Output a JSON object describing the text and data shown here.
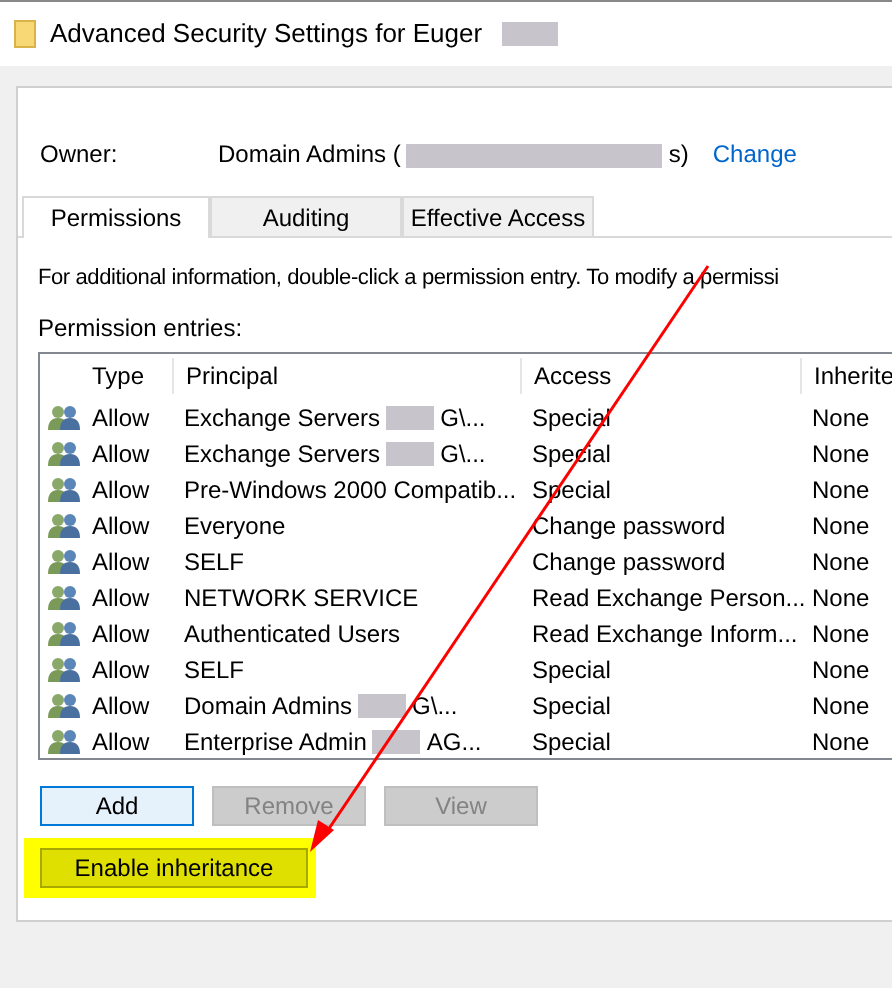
{
  "window": {
    "title": "Advanced Security Settings for Euger"
  },
  "owner": {
    "label": "Owner:",
    "value": "Domain Admins (",
    "value_end": "s)",
    "link": "Change"
  },
  "tabs": [
    {
      "label": "Permissions",
      "selected": true
    },
    {
      "label": "Auditing",
      "selected": false
    },
    {
      "label": "Effective Access",
      "selected": false
    }
  ],
  "info": "For additional information, double-click a permission entry. To modify a permissi",
  "entries_label": "Permission entries:",
  "table": {
    "columns": [
      "Type",
      "Principal",
      "Access",
      "Inherite"
    ],
    "rows": [
      {
        "type": "Allow",
        "principal": "Exchange Servers",
        "principal_end": "G\\...",
        "access": "Special",
        "inherited": "None"
      },
      {
        "type": "Allow",
        "principal": "Exchange Servers",
        "principal_end": "G\\...",
        "access": "Special",
        "inherited": "None"
      },
      {
        "type": "Allow",
        "principal": "Pre-Windows 2000 Compatib...",
        "access": "Special",
        "inherited": "None"
      },
      {
        "type": "Allow",
        "principal": "Everyone",
        "access": "Change password",
        "inherited": "None"
      },
      {
        "type": "Allow",
        "principal": "SELF",
        "access": "Change password",
        "inherited": "None"
      },
      {
        "type": "Allow",
        "principal": "NETWORK SERVICE",
        "access": "Read Exchange Person...",
        "inherited": "None"
      },
      {
        "type": "Allow",
        "principal": "Authenticated Users",
        "access": "Read Exchange Inform...",
        "inherited": "None"
      },
      {
        "type": "Allow",
        "principal": "SELF",
        "access": "Special",
        "inherited": "None"
      },
      {
        "type": "Allow",
        "principal": "Domain Admins",
        "principal_end": "G\\...",
        "access": "Special",
        "inherited": "None"
      },
      {
        "type": "Allow",
        "principal": "Enterprise Admin",
        "principal_end": "AG...",
        "access": "Special",
        "inherited": "None"
      }
    ]
  },
  "buttons": [
    {
      "label": "Add",
      "disabled": false,
      "focused": true
    },
    {
      "label": "Remove",
      "disabled": true,
      "focused": false
    },
    {
      "label": "View",
      "disabled": true,
      "focused": false
    }
  ],
  "inheritance_button": {
    "label": "Enable inheritance",
    "highlighted": true
  }
}
